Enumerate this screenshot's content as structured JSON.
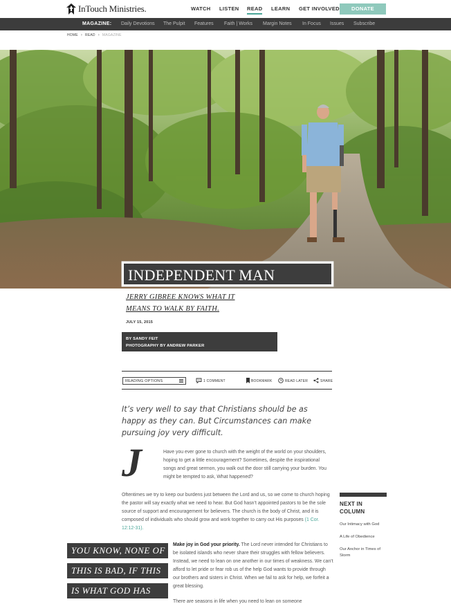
{
  "header": {
    "logo_text": "InTouch Ministries.",
    "nav": [
      "WATCH",
      "LISTEN",
      "READ",
      "LEARN",
      "GET INVOLVED"
    ],
    "donate_label": "DONATE"
  },
  "magazine_bar": {
    "label": "MAGAZINE:",
    "items": [
      "Daily Devotions",
      "The Pulpit",
      "Features",
      "Faith | Works",
      "Margin Notes",
      "In Focus",
      "Issues",
      "Subscribe"
    ]
  },
  "breadcrumb": [
    "HOME",
    "READ",
    "MAGAZINE"
  ],
  "article": {
    "title": "INDEPENDENT MAN",
    "subtitle_line1": "JERRY GIBREE KNOWS WHAT IT",
    "subtitle_line2": "MEANS TO WALK BY FAITH.",
    "date": "JULY 15, 2015",
    "byline1": "BY SANDY FEIT",
    "byline2": "PHOTOGRAPHY BY ANDREW PARKER",
    "lede": "It’s very well to say that Christians should be as happy as they can. But Circumstances can make pursuing joy very difficult.",
    "dropcap": "J",
    "para1": "Have you ever gone to church with the weight of the world on your shoulders, hoping to get a little encouragement? Sometimes, despite the inspirational songs and great sermon, you walk out the door still carrying your burden. You might be tempted to ask, What happened?",
    "para2": "Oftentimes we try to keep our burdens just between the Lord and us, so we come to church hoping the pastor will say exactly what we need to hear. But God hasn’t appointed pastors to be the sole source of support and encouragement for believers. The church is the body of Christ, and it is composed of individuals who should grow and work together to carry out His purposes",
    "para2_ref": "(1 Cor. 12:12-31).",
    "para3_bold": "Make joy in God your priority.",
    "para3": " The Lord never intended for Christians to be isolated islands who never share their struggles with fellow believers. Instead, we need to lean on one another in our times of weakness. We can’t afford to let pride or fear rob us of the help God wants to provide through our brothers and sisters in Christ. When we fail to ask for help, we forfeit a great blessing.",
    "para4": "There are seasons in life when you need to lean on someone",
    "pullquote": [
      "YOU KNOW, NONE OF",
      "THIS IS BAD, IF THIS",
      "IS WHAT GOD HAS"
    ]
  },
  "toolbar": {
    "reading_options": "READING OPTIONS",
    "comments": "1 COMMENT",
    "bookmark": "BOOKMARK",
    "read_later": "READ LATER",
    "share": "SHARE"
  },
  "sidebar": {
    "heading_line1": "NEXT IN",
    "heading_line2": "COLUMN",
    "links": [
      "Our Intimacy with God",
      "A Life of Obedience",
      "Our Anchor in Times of Storm"
    ]
  },
  "colors": {
    "accent": "#4aa698",
    "donate": "#8fc9bc",
    "dark": "#3d3d3d"
  },
  "icons": [
    "logo-mark-icon",
    "chevron-right-icon",
    "menu-icon",
    "comment-icon",
    "bookmark-icon",
    "clock-icon",
    "share-icon"
  ]
}
